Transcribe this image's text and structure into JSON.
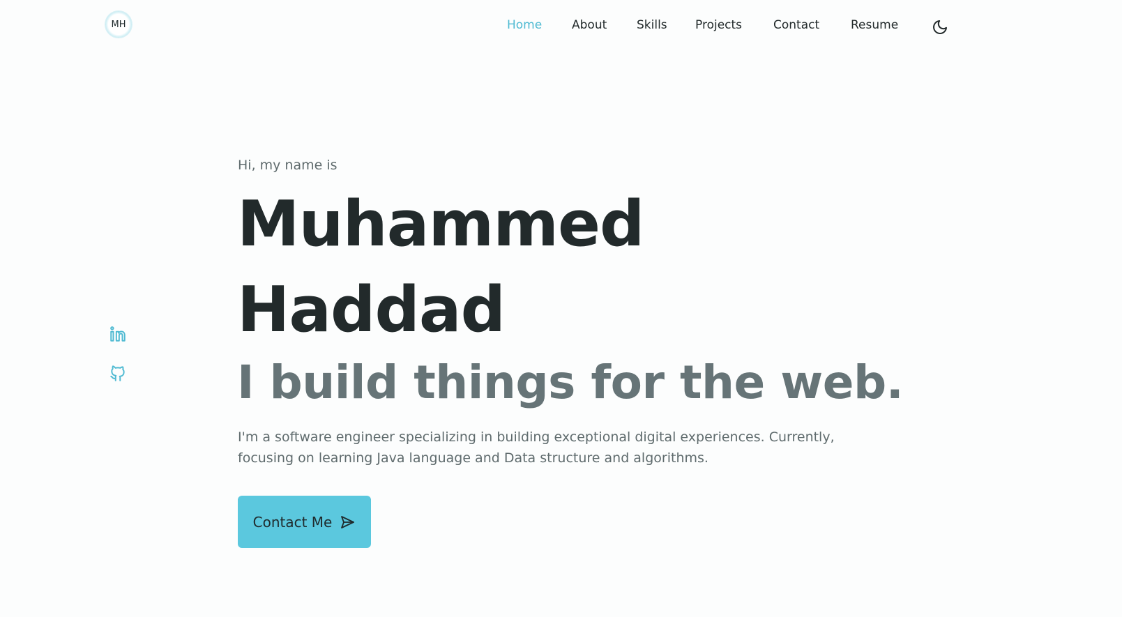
{
  "header": {
    "logo_text": "MH",
    "nav": [
      {
        "label": "Home",
        "active": true
      },
      {
        "label": "About",
        "active": false
      },
      {
        "label": "Skills",
        "active": false
      },
      {
        "label": "Projects",
        "active": false
      },
      {
        "label": "Contact",
        "active": false
      },
      {
        "label": "Resume",
        "active": false
      }
    ],
    "theme_toggle_icon": "moon-icon"
  },
  "social": [
    {
      "icon": "linkedin-icon"
    },
    {
      "icon": "github-icon"
    }
  ],
  "hero": {
    "greeting": "Hi, my name is",
    "name_first": "Muhammed",
    "name_last": "Haddad",
    "tagline": "I build things for the web.",
    "description": "I'm a software engineer specializing in building exceptional digital experiences. Currently, focusing on learning Java language and Data structure and algorithms.",
    "cta_label": "Contact Me",
    "cta_icon": "send-icon"
  },
  "colors": {
    "accent": "#5bc8de",
    "active_nav": "#4fbad2",
    "heading": "#222a2b",
    "tagline": "#667477",
    "body_text": "#5f6b6d",
    "background": "#fcfdfd"
  }
}
